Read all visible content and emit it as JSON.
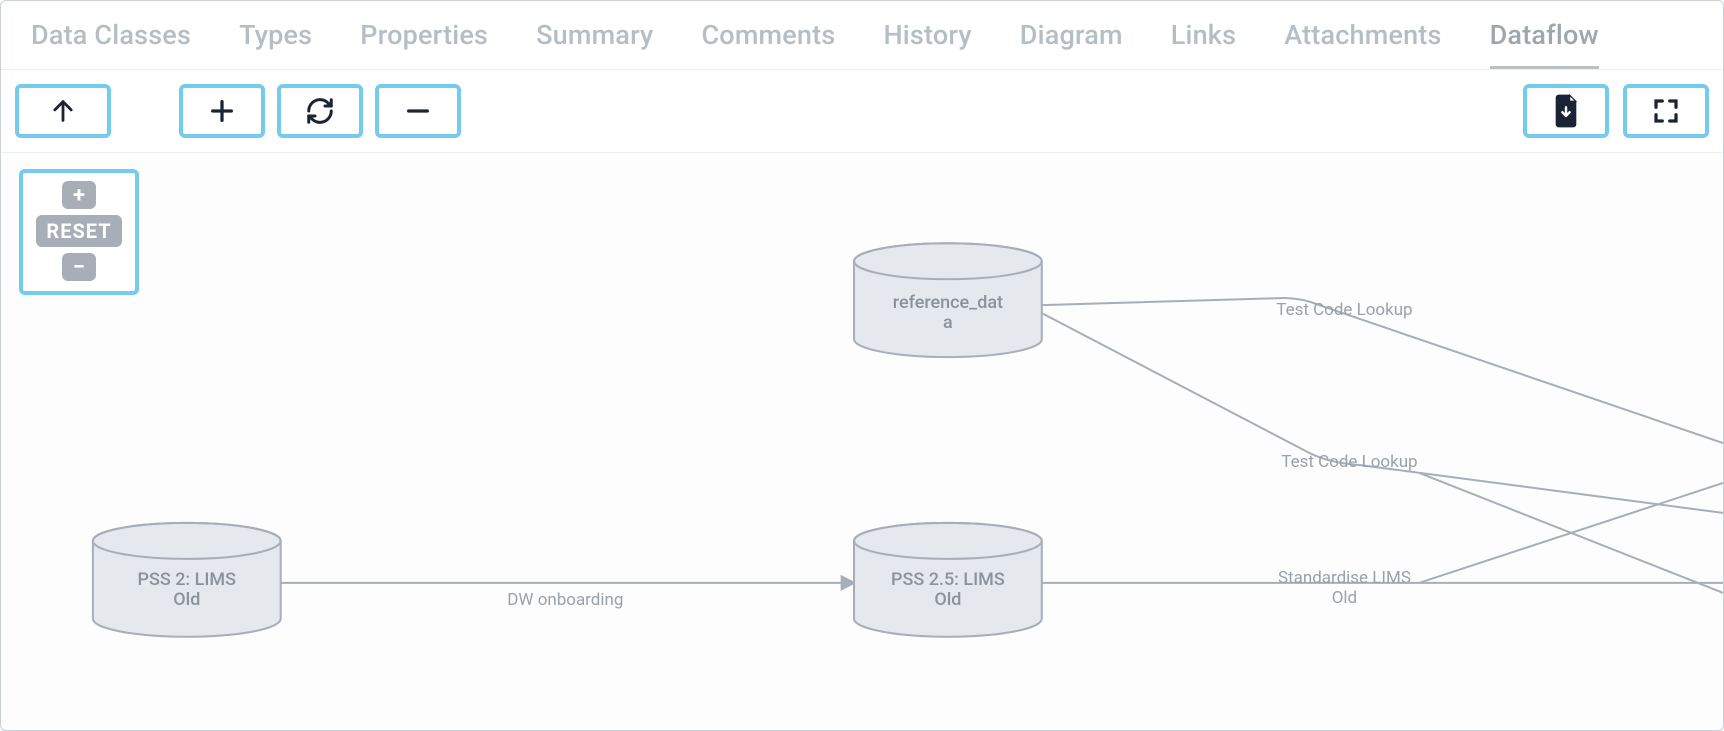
{
  "tabs": {
    "items": [
      "Data Classes",
      "Types",
      "Properties",
      "Summary",
      "Comments",
      "History",
      "Diagram",
      "Links",
      "Attachments",
      "Dataflow"
    ],
    "activeIndex": 9
  },
  "toolbar": {
    "up": "Up",
    "zoom_in": "Zoom in",
    "refresh": "Refresh",
    "zoom_out": "Zoom out",
    "download": "Download",
    "fullscreen": "Fullscreen"
  },
  "canvas": {
    "zoom": {
      "plus": "+",
      "reset": "RESET",
      "minus": "−"
    },
    "nodes": {
      "ref": {
        "line1": "reference_dat",
        "line2": "a"
      },
      "pss2": {
        "line1": "PSS 2: LIMS",
        "line2": "Old"
      },
      "pss25": {
        "line1": "PSS 2.5: LIMS",
        "line2": "Old"
      }
    },
    "edges": {
      "dw": "DW onboarding",
      "tc1": "Test Code Lookup",
      "tc2": "Test Code Lookup",
      "std1": "Standardise LIMS",
      "std2": "Old"
    }
  }
}
